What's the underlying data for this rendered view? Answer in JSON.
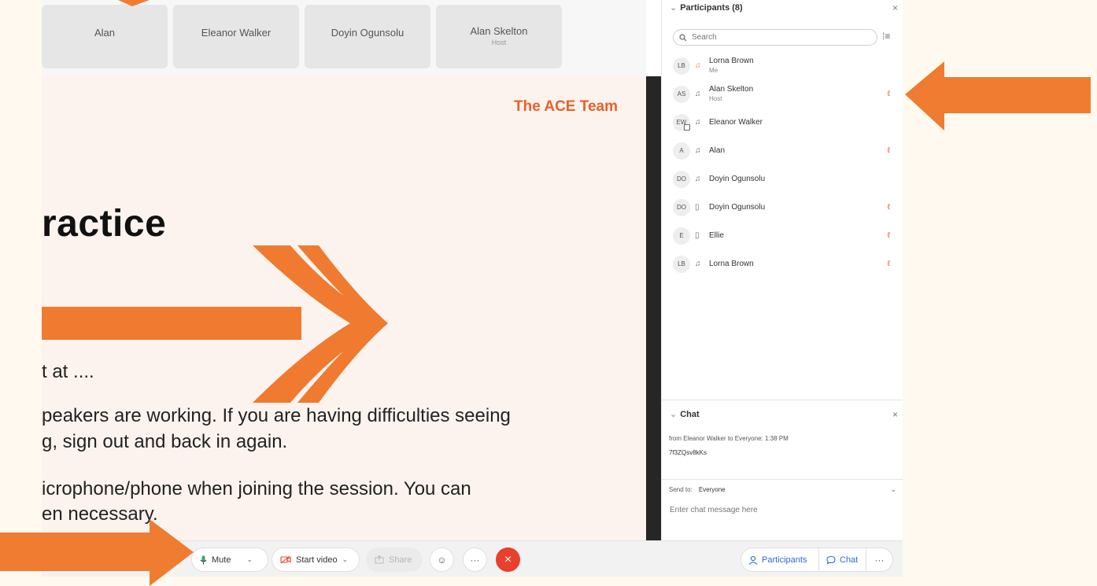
{
  "video_strip": {
    "tiles": [
      {
        "name": "Alan",
        "role": ""
      },
      {
        "name": "Eleanor Walker",
        "role": ""
      },
      {
        "name": "Doyin Ogunsolu",
        "role": ""
      },
      {
        "name": "Alan Skelton",
        "role": "Host"
      }
    ]
  },
  "slide": {
    "team": "The ACE Team",
    "title": "ractice",
    "lines": [
      "t at ....",
      "peakers are working. If you are having difficulties seeing",
      "g, sign out and back in again.",
      "icrophone/phone when joining the session. You can",
      "en necessary."
    ]
  },
  "toolbar": {
    "mute_label": "Mute",
    "start_video_label": "Start video",
    "share_label": "Share",
    "more_label": "···",
    "participants_label": "Participants",
    "chat_label": "Chat",
    "overflow_label": "···"
  },
  "participants_panel": {
    "title": "Participants (8)",
    "close_label": "×",
    "search_placeholder": "Search",
    "items": [
      {
        "initials": "LB",
        "name": "Lorna Brown",
        "sub": "Me",
        "device": "headset",
        "muted": false
      },
      {
        "initials": "AS",
        "name": "Alan Skelton",
        "sub": "Host",
        "device": "headset",
        "muted": true
      },
      {
        "initials": "EW",
        "name": "Eleanor Walker",
        "sub": "",
        "device": "headset",
        "muted": false
      },
      {
        "initials": "A",
        "name": "Alan",
        "sub": "",
        "device": "headset",
        "muted": true
      },
      {
        "initials": "DO",
        "name": "Doyin Ogunsolu",
        "sub": "",
        "device": "headset",
        "muted": false
      },
      {
        "initials": "DO",
        "name": "Doyin Ogunsolu",
        "sub": "",
        "device": "phone",
        "muted": true
      },
      {
        "initials": "E",
        "name": "Ellie",
        "sub": "",
        "device": "phone",
        "muted": true
      },
      {
        "initials": "LB",
        "name": "Lorna Brown",
        "sub": "",
        "device": "headset",
        "muted": true
      }
    ]
  },
  "chat": {
    "title": "Chat",
    "close_label": "×",
    "meta": "from Eleanor Walker to Everyone:   1:38  PM",
    "message": "7f3ZQsv8kKs",
    "send_to_label": "Send to:",
    "send_to_value": "Everyone",
    "input_placeholder": "Enter chat message here"
  },
  "colors": {
    "accent_orange": "#ef7c30",
    "slide_orange": "#e8612c",
    "link_blue": "#2d6ad8",
    "end_red": "#e8402c",
    "mute_red": "#e8473a"
  }
}
